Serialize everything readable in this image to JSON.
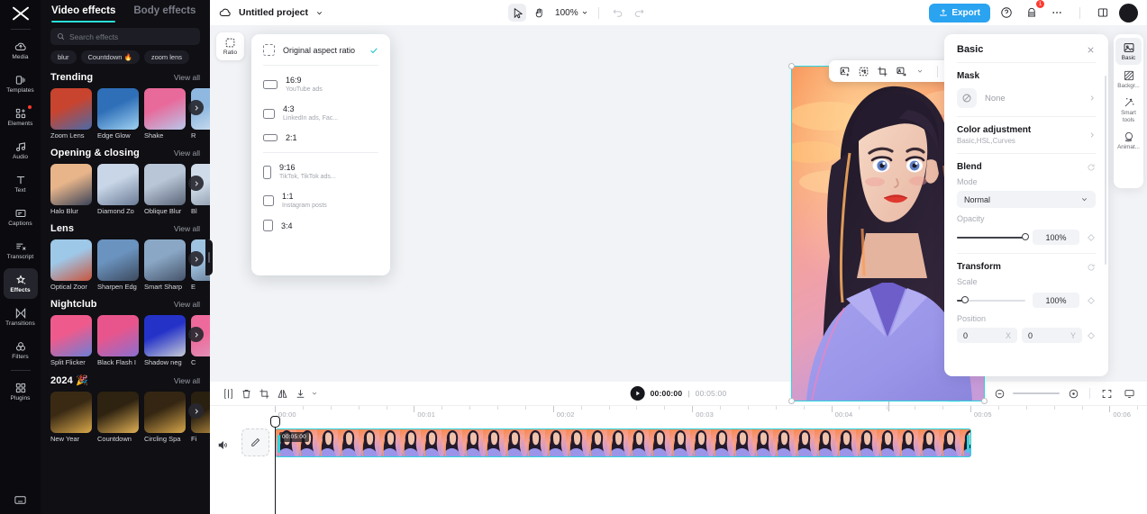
{
  "app": {
    "name": "CapCut"
  },
  "left_rail": {
    "logo_icon": "capcut-logo-icon",
    "items": [
      {
        "label": "Media",
        "icon": "cloud-media-icon",
        "active": false,
        "badge": false
      },
      {
        "label": "Templates",
        "icon": "templates-icon",
        "active": false,
        "badge": false
      },
      {
        "label": "Elements",
        "icon": "elements-icon",
        "active": false,
        "badge": true
      },
      {
        "label": "Audio",
        "icon": "audio-note-icon",
        "active": false,
        "badge": false
      },
      {
        "label": "Text",
        "icon": "text-t-icon",
        "active": false,
        "badge": false
      },
      {
        "label": "Captions",
        "icon": "captions-icon",
        "active": false,
        "badge": false
      },
      {
        "label": "Transcript",
        "icon": "transcript-icon",
        "active": false,
        "badge": false
      },
      {
        "label": "Effects",
        "icon": "effects-sparkle-icon",
        "active": true,
        "badge": false
      },
      {
        "label": "Transitions",
        "icon": "transitions-icon",
        "active": false,
        "badge": false
      },
      {
        "label": "Filters",
        "icon": "filters-icon",
        "active": false,
        "badge": false
      },
      {
        "label": "Plugins",
        "icon": "plugins-grid-icon",
        "active": false,
        "badge": false
      }
    ],
    "bottom_icon": "keyboard-shortcuts-icon"
  },
  "effects_panel": {
    "tabs": [
      {
        "label": "Video effects",
        "active": true
      },
      {
        "label": "Body effects",
        "active": false
      }
    ],
    "search": {
      "placeholder": "Search effects",
      "value": "",
      "icon": "search-icon"
    },
    "chips": [
      {
        "label": "blur",
        "emoji": ""
      },
      {
        "label": "Countdown",
        "emoji": "🔥"
      },
      {
        "label": "zoom lens",
        "emoji": ""
      }
    ],
    "view_all_label": "View all",
    "sections": [
      {
        "title": "Trending",
        "items": [
          {
            "caption": "Zoom Lens",
            "c1": "#c9442f",
            "c2": "#4b6aa8"
          },
          {
            "caption": "Edge Glow",
            "c1": "#2f6fb8",
            "c2": "#9fd2f2"
          },
          {
            "caption": "Shake",
            "c1": "#e86a9b",
            "c2": "#b8c7ea"
          },
          {
            "caption": "R",
            "c1": "#8fb8e0",
            "c2": "#dbe6f2"
          }
        ]
      },
      {
        "title": "Opening & closing",
        "items": [
          {
            "caption": "Halo Blur",
            "c1": "#e8b58a",
            "c2": "#3a4358"
          },
          {
            "caption": "Diamond Zo",
            "c1": "#c9d6e8",
            "c2": "#6b7c96"
          },
          {
            "caption": "Oblique Blur",
            "c1": "#b9c6d8",
            "c2": "#5a6578"
          },
          {
            "caption": "Bl",
            "c1": "#cfdbe8",
            "c2": "#7e8c9e"
          }
        ]
      },
      {
        "title": "Lens",
        "items": [
          {
            "caption": "Optical Zoor",
            "c1": "#9ec8e8",
            "c2": "#c8553d"
          },
          {
            "caption": "Sharpen Edg",
            "c1": "#6b93bf",
            "c2": "#3d4a5e"
          },
          {
            "caption": "Smart Sharp",
            "c1": "#8aa8c6",
            "c2": "#46536a"
          },
          {
            "caption": "E",
            "c1": "#9fc4e2",
            "c2": "#5b6c84"
          }
        ]
      },
      {
        "title": "Nightclub",
        "items": [
          {
            "caption": "Split Flicker",
            "c1": "#ef5a8c",
            "c2": "#6d7fd6"
          },
          {
            "caption": "Black Flash I",
            "c1": "#e8558c",
            "c2": "#8b6fd0"
          },
          {
            "caption": "Shadow neg",
            "c1": "#2432c8",
            "c2": "#c8ccd6"
          },
          {
            "caption": "C",
            "c1": "#ef6a9c",
            "c2": "#d8a0c0"
          }
        ]
      },
      {
        "title": "2024 🎉",
        "items": [
          {
            "caption": "New Year",
            "c1": "#3a2a14",
            "c2": "#d9a84a"
          },
          {
            "caption": "Countdown",
            "c1": "#2e2210",
            "c2": "#e0b055"
          },
          {
            "caption": "Circling Spa",
            "c1": "#342612",
            "c2": "#d7a64b"
          },
          {
            "caption": "Fi",
            "c1": "#2a2010",
            "c2": "#cf9f48"
          }
        ]
      }
    ]
  },
  "topbar": {
    "cloud_icon": "cloud-sync-icon",
    "project_name": "Untitled project",
    "project_chevron": "chevron-down-icon",
    "tools": [
      {
        "name": "select-arrow-tool",
        "active": true
      },
      {
        "name": "hand-pan-tool",
        "active": false
      }
    ],
    "zoom_level": "100%",
    "undo_icon": "undo-icon",
    "redo_icon": "redo-icon",
    "export_label": "Export",
    "export_icon": "export-upload-icon",
    "export_color": "#2aa3f0",
    "help_icon": "help-circle-icon",
    "notifications_icon": "notifications-icon",
    "notifications_badge": "1",
    "more_icon": "more-horizontal-icon",
    "layout_icon": "panel-layout-icon",
    "avatar_icon": "user-avatar"
  },
  "ratio_tool": {
    "label": "Ratio",
    "icon": "aspect-ratio-icon"
  },
  "ratio_menu": {
    "items": [
      {
        "title": "Original aspect ratio",
        "subtitle": "",
        "checked": true,
        "shape": "original",
        "w": 13,
        "h": 13
      },
      {
        "title": "16:9",
        "subtitle": "YouTube ads",
        "checked": false,
        "shape": "rect",
        "w": 16,
        "h": 10
      },
      {
        "title": "4:3",
        "subtitle": "LinkedIn ads, Fac...",
        "checked": false,
        "shape": "rect",
        "w": 13,
        "h": 11
      },
      {
        "title": "2:1",
        "subtitle": "",
        "checked": false,
        "shape": "rect",
        "w": 16,
        "h": 8
      },
      {
        "title": "9:16",
        "subtitle": "TikTok, TikTok ads...",
        "checked": false,
        "shape": "rect",
        "w": 9,
        "h": 15
      },
      {
        "title": "1:1",
        "subtitle": "Instagram posts",
        "checked": false,
        "shape": "rect",
        "w": 12,
        "h": 12
      },
      {
        "title": "3:4",
        "subtitle": "",
        "checked": false,
        "shape": "rect",
        "w": 11,
        "h": 13
      }
    ],
    "check_color": "#1fc4c4"
  },
  "canvas": {
    "selection_color": "#2ad6e0",
    "float_toolbar": [
      {
        "name": "add-image-icon"
      },
      {
        "name": "cutout-icon"
      },
      {
        "name": "crop-icon"
      },
      {
        "name": "replace-icon"
      },
      {
        "name": "chevron-down-icon"
      },
      {
        "name": "more-horizontal-icon"
      }
    ]
  },
  "right_panel": {
    "title": "Basic",
    "close_icon": "close-icon",
    "mask": {
      "label": "Mask",
      "value": "None",
      "icon": "no-mask-icon",
      "chevron": "chevron-right-icon"
    },
    "color_adjustment": {
      "label": "Color adjustment",
      "subtitle": "Basic,HSL,Curves",
      "chevron": "chevron-right-icon"
    },
    "blend": {
      "label": "Blend",
      "reset_icon": "reset-icon",
      "mode_label": "Mode",
      "mode_value": "Normal",
      "opacity_label": "Opacity",
      "opacity_value": "100%",
      "opacity_percent": 100,
      "keyframe_icon": "keyframe-diamond-icon"
    },
    "transform": {
      "label": "Transform",
      "reset_icon": "reset-icon",
      "scale_label": "Scale",
      "scale_value": "100%",
      "scale_percent": 12,
      "position_label": "Position",
      "position_x": "0",
      "position_y": "0",
      "axis_x": "X",
      "axis_y": "Y",
      "keyframe_icon": "keyframe-diamond-icon"
    }
  },
  "right_rail": {
    "items": [
      {
        "label": "Basic",
        "icon": "basic-image-icon",
        "active": true
      },
      {
        "label": "Backgr...",
        "icon": "background-icon",
        "active": false
      },
      {
        "label": "Smart tools",
        "icon": "smart-tools-wand-icon",
        "active": false
      },
      {
        "label": "Animat...",
        "icon": "animation-icon",
        "active": false
      }
    ]
  },
  "timeline": {
    "left_tools": [
      {
        "name": "split-marker-icon"
      },
      {
        "name": "delete-trash-icon"
      },
      {
        "name": "crop-frame-icon"
      },
      {
        "name": "mirror-flip-icon"
      },
      {
        "name": "download-icon"
      },
      {
        "name": "chevron-down-icon"
      }
    ],
    "play_icon": "play-icon",
    "current_time": "00:00:00",
    "total_time": "00:05:00",
    "separator": "|",
    "right_tools": [
      {
        "name": "microphone-icon",
        "active": false
      },
      {
        "name": "auto-cut-ai-icon",
        "active": true
      },
      {
        "name": "split-clip-icon",
        "active": false
      },
      {
        "name": "zoom-out-icon",
        "active": false
      },
      {
        "name": "zoom-in-icon",
        "active": false
      },
      {
        "name": "fit-to-screen-icon",
        "active": false
      },
      {
        "name": "preview-monitor-icon",
        "active": false
      }
    ],
    "ruler_labels": [
      "00:00",
      "00:01",
      "00:02",
      "00:03",
      "00:04",
      "00:05",
      "00:06"
    ],
    "track": {
      "volume_icon": "speaker-volume-icon",
      "edit_icon": "edit-pencil-icon",
      "clip_duration_label": "00:05:00"
    },
    "playhead_time": "00:00:00"
  }
}
